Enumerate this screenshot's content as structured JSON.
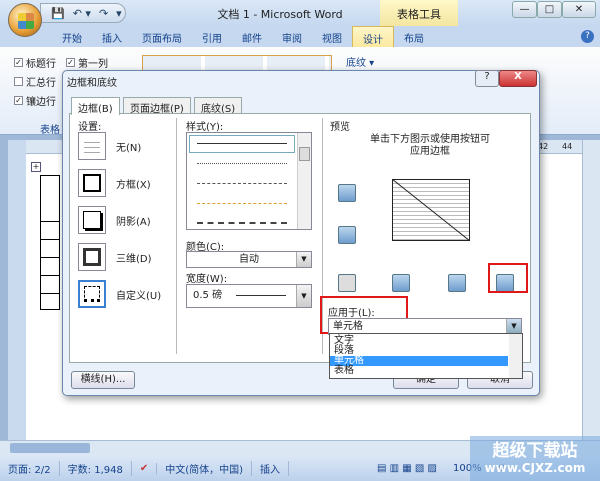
{
  "window": {
    "title": "文档 1 - Microsoft Word",
    "context_tab": "表格工具",
    "minimize": "—",
    "maximize": "□",
    "close": "✕"
  },
  "qat": {
    "save": "💾",
    "undo": "↶ ▾",
    "redo": "↷",
    "customize": "▾"
  },
  "ribbon": {
    "tabs": [
      "开始",
      "插入",
      "页面布局",
      "引用",
      "邮件",
      "审阅",
      "视图",
      "设计",
      "布局"
    ],
    "active_tab": "设计",
    "help": "?",
    "options": [
      {
        "label": "标题行",
        "checked": true
      },
      {
        "label": "第一列",
        "checked": true
      },
      {
        "label": "汇总行",
        "checked": false
      },
      {
        "label": "镶边行",
        "checked": true
      }
    ],
    "group_label": "表格",
    "shading": "底纹 ▾"
  },
  "dialog": {
    "title": "边框和底纹",
    "help": "?",
    "close": "X",
    "tabs": [
      "边框(B)",
      "页面边框(P)",
      "底纹(S)"
    ],
    "setting_label": "设置:",
    "settings": [
      "无(N)",
      "方框(X)",
      "阴影(A)",
      "三维(D)",
      "自定义(U)"
    ],
    "style_label": "样式(Y):",
    "color_label": "颜色(C):",
    "color_value": "自动",
    "width_label": "宽度(W):",
    "width_value": "0.5 磅",
    "preview_label": "预览",
    "preview_hint_1": "单击下方图示或使用按钮可",
    "preview_hint_2": "应用边框",
    "apply_label": "应用于(L):",
    "apply_value": "单元格",
    "apply_options": [
      "文字",
      "段落",
      "单元格",
      "表格"
    ],
    "apply_selected": "单元格",
    "hline_button": "横线(H)...",
    "ok_button": "确定",
    "cancel_button": "取消"
  },
  "ruler": {
    "marks": [
      "42",
      "44"
    ]
  },
  "status": {
    "page": "页面: 2/2",
    "words": "字数: 1,948",
    "language": "中文(简体，中国)",
    "mode": "插入",
    "zoom": "100%"
  },
  "watermark": {
    "line1": "超级下载站",
    "line2": "www.CJXZ.com"
  }
}
